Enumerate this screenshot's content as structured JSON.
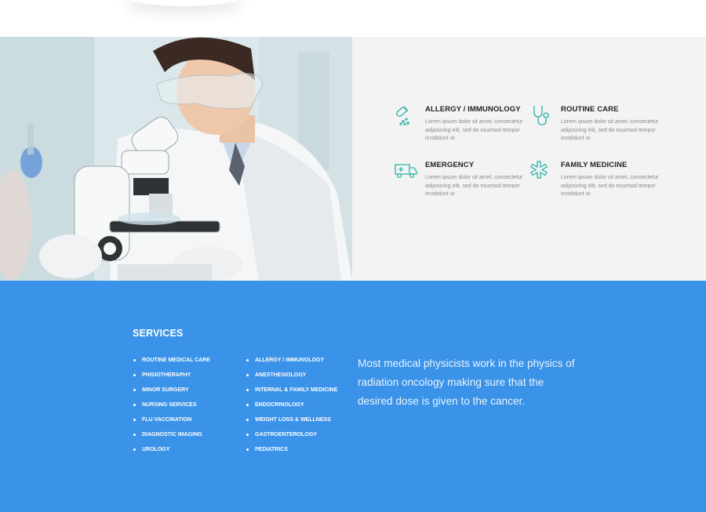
{
  "features": [
    {
      "icon": "pills-icon",
      "title": "ALLERGY / IMMUNOLOGY",
      "description": "Lorem ipsum dolor sit amet, consectetur adipisicing elit, sed do eiusmod tempor incididunt ut"
    },
    {
      "icon": "stethoscope-icon",
      "title": "ROUTINE CARE",
      "description": "Lorem ipsum dolor sit amet, consectetur adipisicing elit, sed do eiusmod tempor incididunt ut"
    },
    {
      "icon": "ambulance-icon",
      "title": "EMERGENCY",
      "description": "Lorem ipsum dolor sit amet, consectetur adipisicing elit, sed do eiusmod tempor incididunt ut"
    },
    {
      "icon": "medical-star-icon",
      "title": "FAMILY MEDICINE",
      "description": "Lorem ipsum dolor sit amet, consectetur adipisicing elit, sed do eiusmod tempor incididunt ut"
    }
  ],
  "services": {
    "title": "SERVICES",
    "column_a": [
      "ROUTINE MEDICAL CARE",
      "PHISIOTHERAPHY",
      "MINOR SURGERY",
      "NURSING SERVICES",
      "FLU VACCINATION",
      "DIAGNOSTIC IMAGING",
      "UROLOGY"
    ],
    "column_b": [
      "ALLERGY / IMMUNOLOGY",
      "ANESTHESIOLOGY",
      "INTERNAL & FAMILY MEDICINE",
      "ENDOCRINOLOGY",
      "WEIGHT LOSS & WELLNESS",
      "GASTROENTEROLOGY",
      "PEDIATRICS"
    ],
    "quote": "Most medical physicists work in the physics of radiation oncology making sure that the desired dose is given to the cancer."
  },
  "colors": {
    "accent_blue": "#3a93e8",
    "icon_teal": "#2bb3a6",
    "panel_gray": "#f3f3f3"
  }
}
